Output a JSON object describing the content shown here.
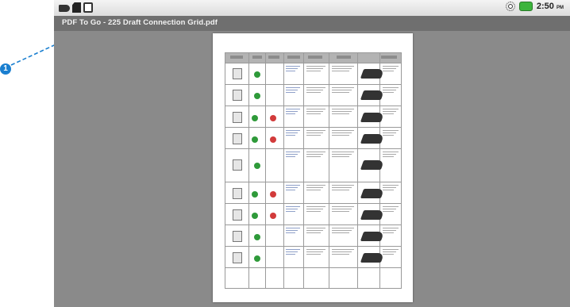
{
  "status_bar": {
    "time": "2:50",
    "ampm": "PM",
    "icons_left": [
      "usb-icon",
      "sd-card-icon",
      "android-debug-icon"
    ],
    "icons_right": [
      "signal-icon",
      "battery-icon"
    ]
  },
  "title_bar": {
    "title": "PDF To Go - 225 Draft Connection Grid.pdf"
  },
  "callout": {
    "number": "1",
    "color": "#1a7fd0"
  },
  "document": {
    "row_count": 9,
    "green_status_color": "#2f9a3a",
    "red_status_color": "#d23b3b"
  }
}
